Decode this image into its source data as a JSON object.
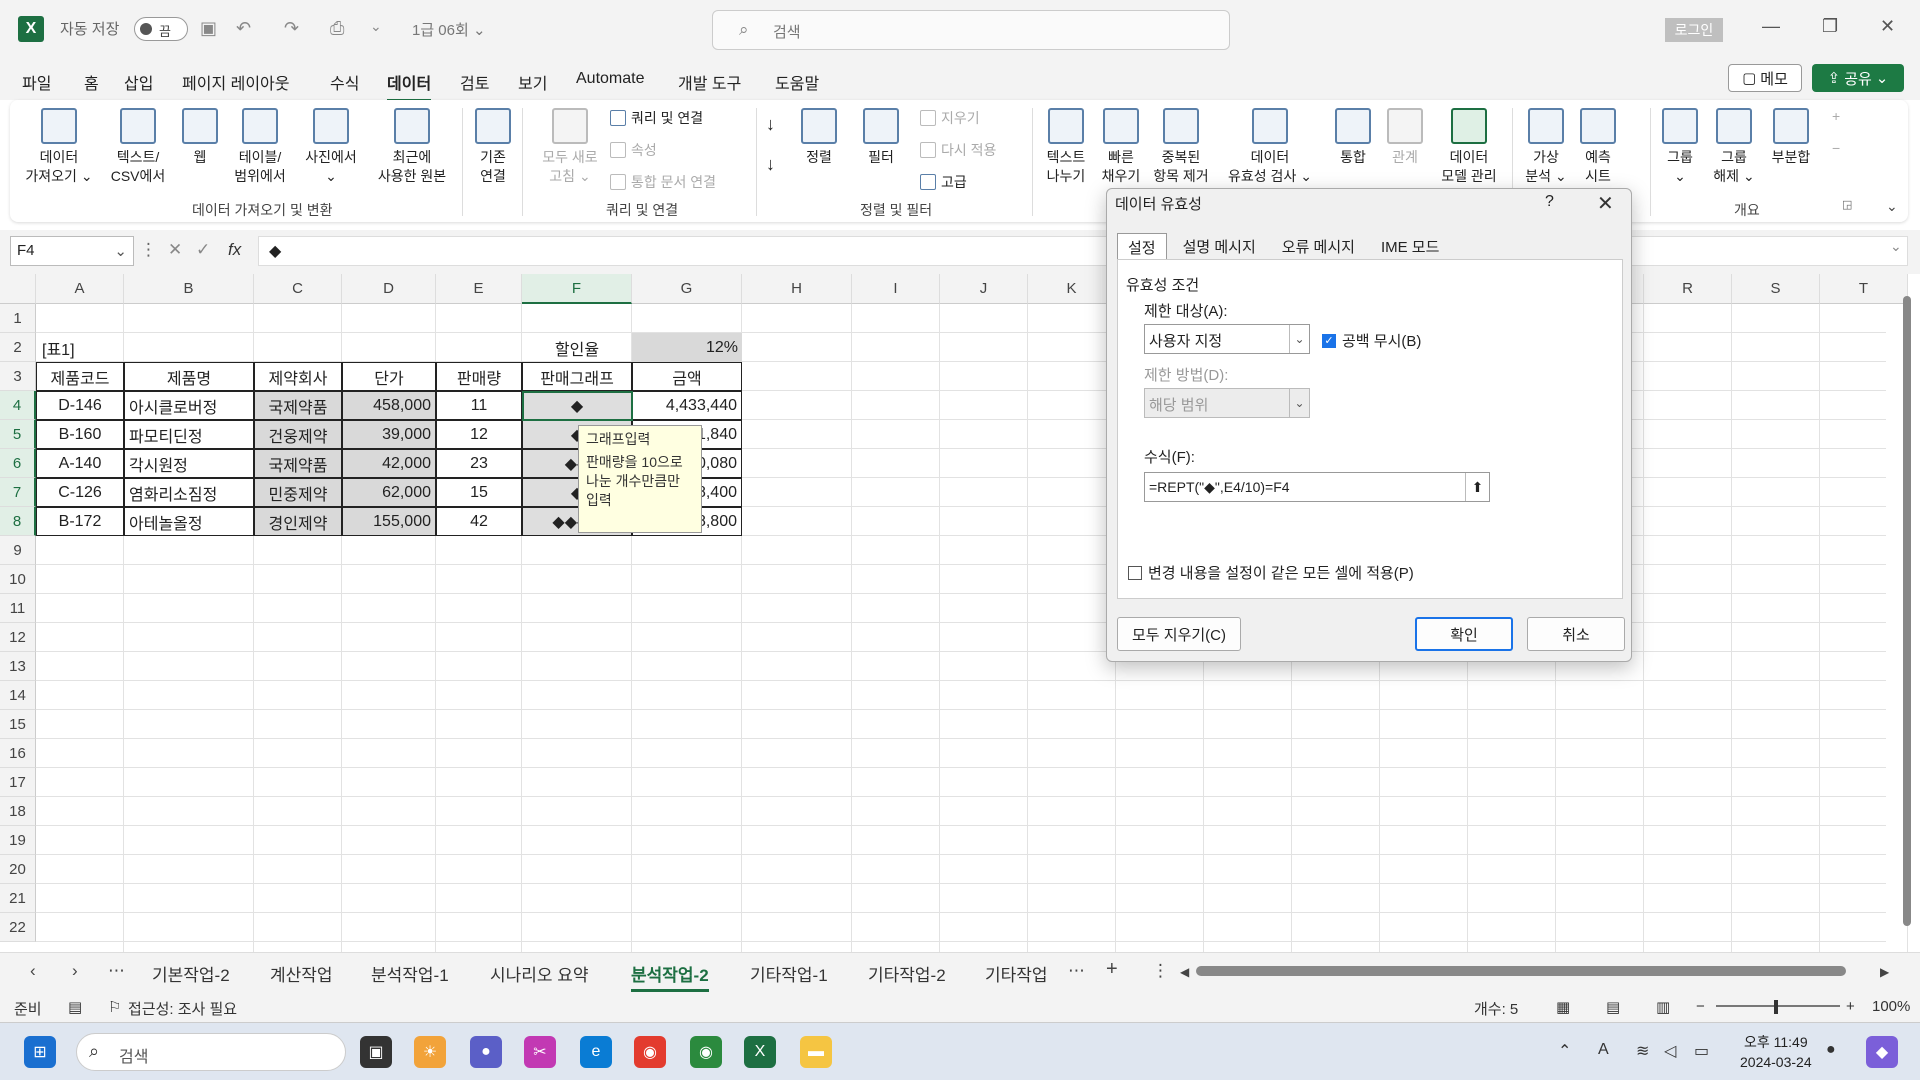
{
  "titlebar": {
    "app_logo": "X",
    "autosave_label": "자동 저장",
    "autosave_state": "끔",
    "doc_title": "1급 06회 ⌄",
    "search_placeholder": "검색",
    "login_label": "로그인"
  },
  "menu": {
    "tabs": [
      "파일",
      "홈",
      "삽입",
      "페이지 레이아웃",
      "수식",
      "데이터",
      "검토",
      "보기",
      "Automate",
      "개발 도구",
      "도움말"
    ],
    "active": "데이터",
    "memo_label": "메모",
    "share_label": "공유"
  },
  "ribbon": {
    "get_data": "데이터\n가져오기 ⌄",
    "text_csv": "텍스트/\nCSV에서",
    "web": "웹",
    "table_range": "테이블/\n범위에서",
    "from_picture": "사진에서\n⌄",
    "recent_sources": "최근에\n사용한 원본",
    "existing_conn": "기존\n연결",
    "group1_label": "데이터 가져오기 및 변환",
    "refresh_all": "모두 새로\n고침 ⌄",
    "queries_conn": "쿼리 및 연결",
    "properties": "속성",
    "edit_links": "통합 문서 연결",
    "group2_label": "쿼리 및 연결",
    "sort": "정렬",
    "filter": "필터",
    "clear": "지우기",
    "reapply": "다시 적용",
    "advanced": "고급",
    "group3_label": "정렬 및 필터",
    "text_to_col": "텍스트\n나누기",
    "flash_fill": "빠른\n채우기",
    "remove_dup": "중복된\n항목 제거",
    "data_valid": "데이터\n유효성 검사 ⌄",
    "consolidate": "통합",
    "relationships": "관계",
    "data_model": "데이터\n모델 관리",
    "whatif": "가상\n분석 ⌄",
    "forecast": "예측\n시트",
    "group": "그룹\n⌄",
    "ungroup": "그룹\n해제 ⌄",
    "subtotal": "부분합",
    "group5_label": "개요"
  },
  "formula_bar": {
    "name_box": "F4",
    "fx": "fx",
    "content": "◆"
  },
  "grid": {
    "columns": [
      "A",
      "B",
      "C",
      "D",
      "E",
      "F",
      "G",
      "H",
      "I",
      "J",
      "K",
      "L",
      "M",
      "N",
      "O",
      "P",
      "Q",
      "R",
      "S",
      "T"
    ],
    "rows": [
      "1",
      "2",
      "3",
      "4",
      "5",
      "6",
      "7",
      "8",
      "9",
      "10",
      "11",
      "12",
      "13",
      "14",
      "15",
      "16",
      "17",
      "18",
      "19",
      "20",
      "21",
      "22"
    ],
    "table_label": "[표1]",
    "discount_label": "할인율",
    "discount_value": "12%",
    "headers": [
      "제품코드",
      "제품명",
      "제약회사",
      "단가",
      "판매량",
      "판매그래프",
      "금액"
    ],
    "data_rows": [
      [
        "D-146",
        "아시클로버정",
        "국제약품",
        "458,000",
        "11",
        "◆",
        "4,433,440"
      ],
      [
        "B-160",
        "파모티딘정",
        "건웅제약",
        "39,000",
        "12",
        "◆",
        "411,840"
      ],
      [
        "A-140",
        "각시원정",
        "국제약품",
        "42,000",
        "23",
        "◆◆",
        "850,080"
      ],
      [
        "C-126",
        "염화리소짐정",
        "민중제약",
        "62,000",
        "15",
        "◆",
        "818,400"
      ],
      [
        "B-172",
        "아테놀올정",
        "경인제약",
        "155,000",
        "42",
        "◆◆◆◆",
        "5,728,800"
      ]
    ],
    "tooltip_title": "그래프입력",
    "tooltip_body": "판매량을 10으로 나눈 개수만큼만 입력"
  },
  "dialog": {
    "title": "데이터 유효성",
    "help": "?",
    "close": "✕",
    "tabs": [
      "설정",
      "설명 메시지",
      "오류 메시지",
      "IME 모드"
    ],
    "section": "유효성 조건",
    "allow_label": "제한 대상(A):",
    "allow_value": "사용자 지정",
    "ignore_blank": "공백 무시(B)",
    "data_label": "제한 방법(D):",
    "data_value": "해당 범위",
    "formula_label": "수식(F):",
    "formula_value": "=REPT(\"◆\",E4/10)=F4",
    "apply_all": "변경 내용을 설정이 같은 모든 셀에 적용(P)",
    "clear_all": "모두 지우기(C)",
    "ok": "확인",
    "cancel": "취소"
  },
  "sheets": {
    "tabs": [
      "기본작업-2",
      "계산작업",
      "분석작업-1",
      "시나리오 요약",
      "분석작업-2",
      "기타작업-1",
      "기타작업-2",
      "기타작업"
    ],
    "active": "분석작업-2"
  },
  "status": {
    "ready": "준비",
    "accessibility": "접근성: 조사 필요",
    "count": "개수: 5",
    "zoom": "100%"
  },
  "taskbar": {
    "search": "검색",
    "time": "오후 11:49",
    "date": "2024-03-24"
  },
  "colors": {
    "excel_green": "#1d6f42",
    "dialog_blue": "#1a73e8",
    "cell_gray": "#d9d9d9"
  }
}
